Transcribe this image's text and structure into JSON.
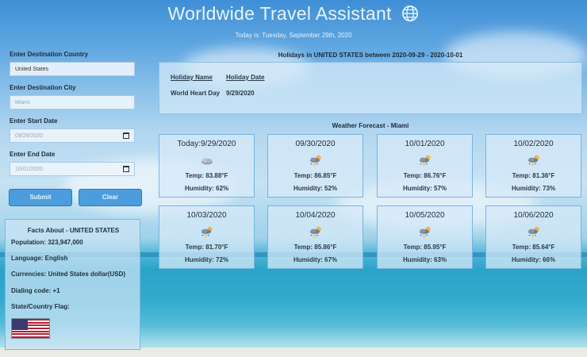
{
  "header": {
    "title": "Worldwide Travel Assistant",
    "date_prefix": "Today is:",
    "date_value": "Tuesday, September 29th, 2020"
  },
  "form": {
    "country_label": "Enter Destination Country",
    "country_value": "United States",
    "city_label": "Enter Destination City",
    "city_placeholder": "Miami",
    "start_label": "Enter Start Date",
    "start_value": "09/29/2020",
    "end_label": "Enter End Date",
    "end_value": "10/01/2020",
    "submit_label": "Submit",
    "clear_label": "Clear"
  },
  "facts": {
    "title": "Facts About - UNITED STATES",
    "population": "Population: 323,947,000",
    "language": "Language: English",
    "currencies": "Currencies: United States dollar(USD)",
    "dialing": "Dialing code: +1",
    "flag_label": "State/Country Flag:"
  },
  "holidays": {
    "title": "Holidays in UNITED STATES between 2020-09-29 - 2020-10-01",
    "col_name": "Holiday Name",
    "col_date": "Holiday Date",
    "rows": [
      {
        "name": "World Heart Day",
        "date": "9/29/2020"
      }
    ]
  },
  "forecast": {
    "title": "Weather Forecast - Miami",
    "days": [
      {
        "date": "Today:9/29/2020",
        "temp": "Temp: 83.88°F",
        "humidity": "Humidity: 62%",
        "icon": "cloudy-icon"
      },
      {
        "date": "09/30/2020",
        "temp": "Temp: 86.85°F",
        "humidity": "Humidity: 52%",
        "icon": "thunderstorm-sun-icon"
      },
      {
        "date": "10/01/2020",
        "temp": "Temp: 86.76°F",
        "humidity": "Humidity: 57%",
        "icon": "thunderstorm-sun-icon"
      },
      {
        "date": "10/02/2020",
        "temp": "Temp: 81.36°F",
        "humidity": "Humidity: 73%",
        "icon": "thunderstorm-sun-icon"
      },
      {
        "date": "10/03/2020",
        "temp": "Temp: 81.70°F",
        "humidity": "Humidity: 72%",
        "icon": "thunderstorm-sun-icon"
      },
      {
        "date": "10/04/2020",
        "temp": "Temp: 85.86°F",
        "humidity": "Humidity: 67%",
        "icon": "thunderstorm-sun-icon"
      },
      {
        "date": "10/05/2020",
        "temp": "Temp: 85.95°F",
        "humidity": "Humidity: 63%",
        "icon": "thunderstorm-sun-icon"
      },
      {
        "date": "10/06/2020",
        "temp": "Temp: 85.64°F",
        "humidity": "Humidity: 66%",
        "icon": "thunderstorm-sun-icon"
      }
    ]
  },
  "colors": {
    "button_bg": "#4c9ddd",
    "panel_border": "#78b3e0"
  }
}
